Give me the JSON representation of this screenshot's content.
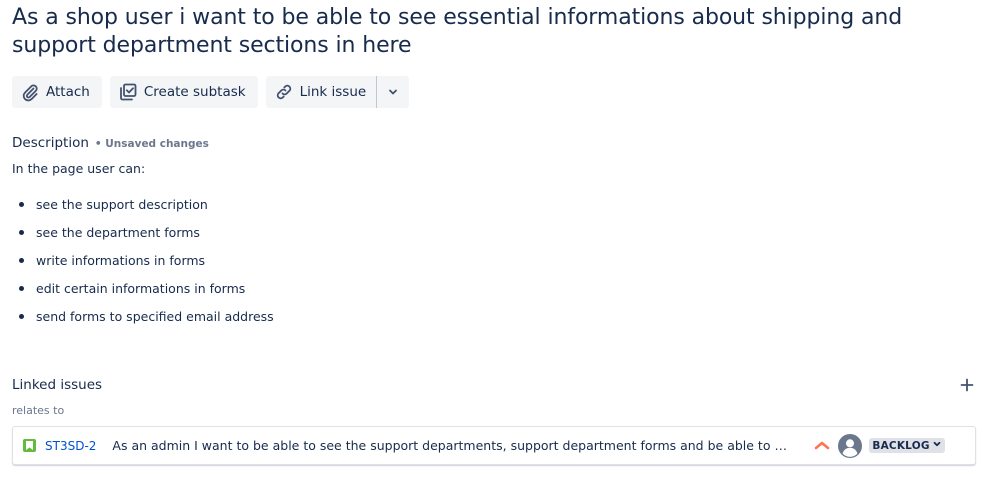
{
  "issue": {
    "title": "As a shop user i want to be able to see essential informations about shipping and support department sections in here"
  },
  "toolbar": {
    "attach_label": "Attach",
    "create_subtask_label": "Create subtask",
    "link_issue_label": "Link issue"
  },
  "description": {
    "heading": "Description",
    "unsaved": "• Unsaved changes",
    "intro": "In the page user can:",
    "items": [
      "see the support description",
      "see the department forms",
      "write informations in forms",
      "edit certain informations in forms",
      "send forms to specified email address"
    ]
  },
  "linked_issues": {
    "heading": "Linked issues",
    "relation": "relates to",
    "items": [
      {
        "key": "ST3SD-2",
        "summary": "As an admin I want to be able to see the support departments, support department forms and be able to writ...",
        "status": "BACKLOG",
        "priority_icon": "priority-high-icon",
        "type_icon": "story-icon"
      }
    ]
  },
  "colors": {
    "text": "#172b4d",
    "link": "#0052cc",
    "button_bg": "#f4f5f7",
    "subtle_text": "#6b778c",
    "story_green": "#63ba3c",
    "priority_orange": "#ff7452"
  }
}
